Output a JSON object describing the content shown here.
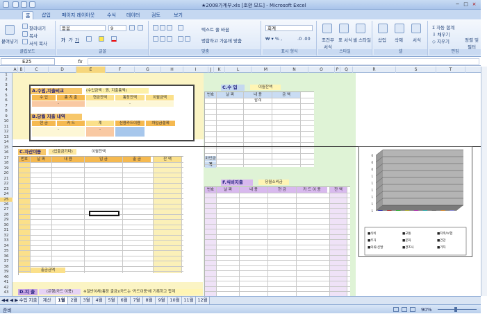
{
  "window": {
    "title": "★2008가계부.xls [호환 모드] - Microsoft Excel"
  },
  "office_button": "",
  "tabs": [
    "홈",
    "삽입",
    "페이지 레이아웃",
    "수식",
    "데이터",
    "검토",
    "보기"
  ],
  "ribbon": {
    "clipboard": {
      "paste": "붙여넣기",
      "cut": "잘라내기",
      "copy": "복사",
      "format_painter": "서식 복사",
      "label": "클립보드"
    },
    "font": {
      "name": "돋움",
      "size": "9",
      "label": "글꼴"
    },
    "align": {
      "wrap": "텍스트 줄 바꿈",
      "merge": "병합하고 가운데 맞춤",
      "label": "맞춤"
    },
    "number": {
      "format": "회계",
      "label": "표시 형식"
    },
    "styles": {
      "cond": "조건부 서식",
      "table": "표 서식",
      "cell": "셀 스타일",
      "label": "스타일"
    },
    "cells": {
      "insert": "삽입",
      "delete": "삭제",
      "format": "서식",
      "label": "셀"
    },
    "edit": {
      "autosum": "자동 합계",
      "fill": "채우기",
      "clear": "지우기",
      "sort": "정렬 및 필터",
      "label": "편집"
    }
  },
  "formula_bar": {
    "cell": "E25",
    "fx": "fx",
    "value": ""
  },
  "columns": [
    "A",
    "B",
    "C",
    "D",
    "E",
    "F",
    "G",
    "H",
    "I",
    "J",
    "K",
    "L",
    "M",
    "N",
    "O",
    "P",
    "Q",
    "R",
    "S",
    "T"
  ],
  "rows": [
    "1",
    "2",
    "3",
    "4",
    "5",
    "6",
    "7",
    "8",
    "9",
    "10",
    "11",
    "12",
    "13",
    "14",
    "15",
    "16",
    "17",
    "18",
    "19",
    "20",
    "21",
    "22",
    "23",
    "24",
    "25",
    "26",
    "27",
    "28",
    "29",
    "30",
    "31",
    "32",
    "33",
    "34",
    "35",
    "36",
    "37",
    "38",
    "39",
    "40",
    "41",
    "42",
    "43"
  ],
  "sheet": {
    "a_title": "A.수입,지출비교",
    "a_note": "(수입금액 : 원, 지출총액)",
    "a_cols": [
      "수 입",
      "총 지 출",
      "현금잔액",
      "통장잔액",
      "이월금액"
    ],
    "a_dash": "-",
    "b_title": "B.당월 지출 내역",
    "b_cols": [
      "현 금",
      "카 드",
      "계",
      "신용카드이용",
      "차입금결제"
    ],
    "c_title": "C.수 입",
    "c_prev": "이월잔액",
    "c_cols": [
      "번호",
      "날 짜",
      "내 용",
      "금 액"
    ],
    "c_sum": "합계",
    "c_ps": "차입금",
    "c_total": "계",
    "d_title": "C.자산이동",
    "d_note": "(입출금기타)",
    "d_prev": "이월잔액",
    "d_cols": [
      "번호",
      "날 짜",
      "내 용",
      "입 금",
      "출 금",
      "잔 액"
    ],
    "d_foot": "출금금액",
    "e_title": "D.지 출",
    "e_note": "(은행/카드 이용)",
    "e_hint": "※일반이체(통장 출금)/카드는 '카드이용'에 기록하고 합계",
    "f_title": "F.식비지출",
    "f_prev": "당월소비금",
    "f_cols": [
      "번호",
      "날 짜",
      "내 용",
      "현 금",
      "카 드 이 용",
      "잔 액"
    ]
  },
  "chart_data": {
    "type": "bar",
    "categories": [
      "",
      "",
      "",
      "",
      "",
      "",
      "",
      "",
      ""
    ],
    "values": [
      0,
      0,
      0,
      0,
      0,
      0,
      0,
      0,
      0
    ],
    "ylim": [
      0,
      1
    ],
    "yticks": [
      "1",
      "1",
      "1",
      "1",
      "1",
      "1",
      "0",
      "0",
      "0"
    ],
    "legend": [
      "■식비",
      "■교통",
      "■저축/보험",
      "■주거",
      "■문화",
      "■건강",
      "■의류/신발",
      "■경조사",
      "■기타"
    ]
  },
  "sheet_tabs": [
    "수입 지출",
    "계산",
    "1월",
    "2월",
    "3월",
    "4월",
    "5월",
    "6월",
    "7월",
    "8월",
    "9월",
    "10월",
    "11월",
    "12월"
  ],
  "status": {
    "ready": "준비",
    "zoom": "90%"
  }
}
